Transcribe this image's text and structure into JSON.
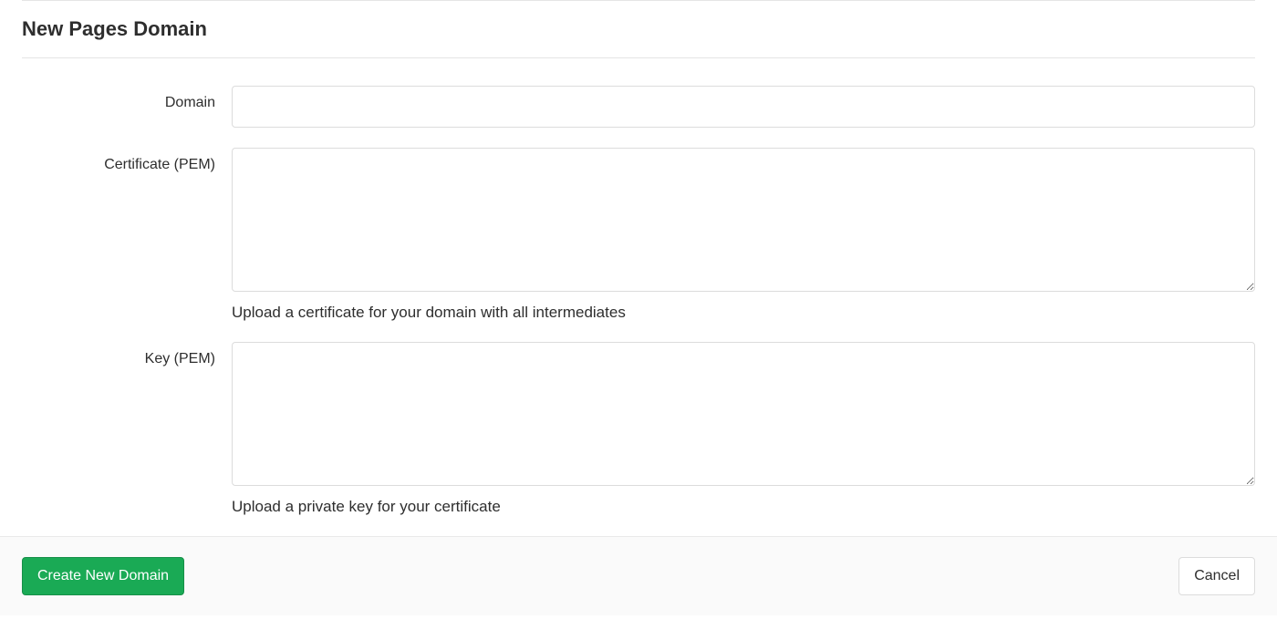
{
  "page": {
    "title": "New Pages Domain"
  },
  "form": {
    "domain": {
      "label": "Domain",
      "value": ""
    },
    "certificate": {
      "label": "Certificate (PEM)",
      "value": "",
      "help": "Upload a certificate for your domain with all intermediates"
    },
    "key": {
      "label": "Key (PEM)",
      "value": "",
      "help": "Upload a private key for your certificate"
    }
  },
  "actions": {
    "submit": "Create New Domain",
    "cancel": "Cancel"
  }
}
